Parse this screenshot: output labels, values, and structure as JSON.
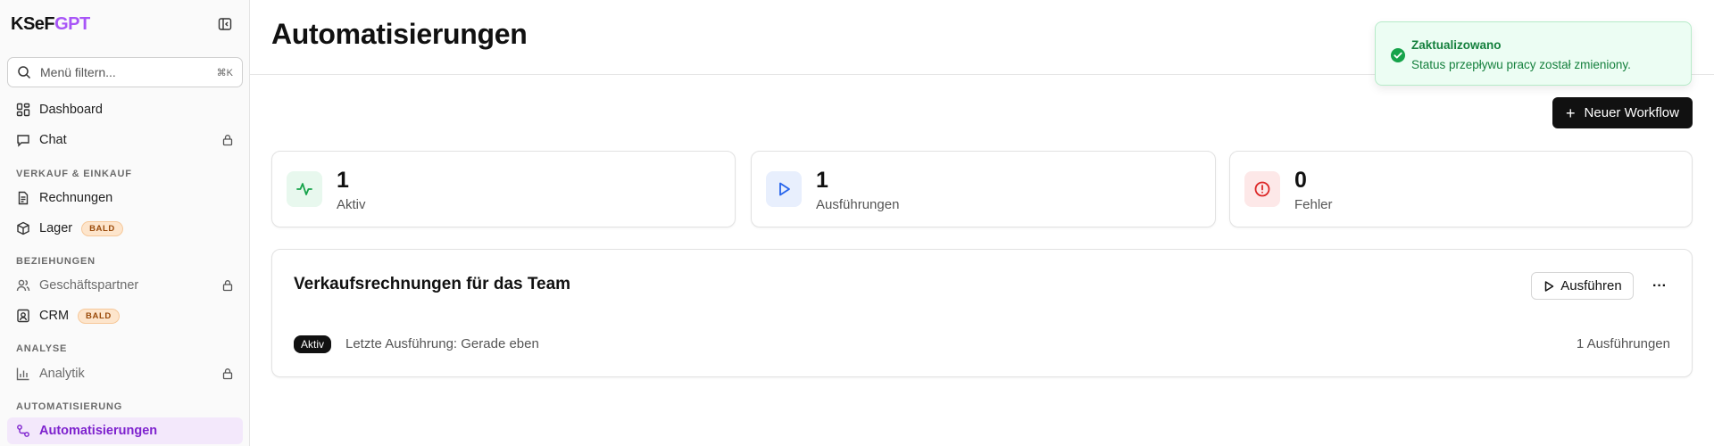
{
  "brand": {
    "part1": "KSeF",
    "part2": "GPT"
  },
  "search": {
    "placeholder": "Menü filtern...",
    "shortcut": "⌘K"
  },
  "sidebar": {
    "items_top": [
      {
        "label": "Dashboard",
        "icon": "dashboard-icon",
        "locked": false
      },
      {
        "label": "Chat",
        "icon": "chat-icon",
        "locked": true
      }
    ],
    "sections": [
      {
        "title": "VERKAUF & EINKAUF",
        "items": [
          {
            "label": "Rechnungen",
            "icon": "invoice-icon"
          },
          {
            "label": "Lager",
            "icon": "package-icon",
            "badge": "BALD"
          }
        ]
      },
      {
        "title": "BEZIEHUNGEN",
        "items": [
          {
            "label": "Geschäftspartner",
            "icon": "users-icon",
            "locked": true
          },
          {
            "label": "CRM",
            "icon": "contact-icon",
            "badge": "BALD"
          }
        ]
      },
      {
        "title": "ANALYSE",
        "items": [
          {
            "label": "Analytik",
            "icon": "bar-chart-icon",
            "locked": true
          }
        ]
      },
      {
        "title": "AUTOMATISIERUNG",
        "items": [
          {
            "label": "Automatisierungen",
            "icon": "workflow-icon",
            "active": true
          }
        ]
      }
    ]
  },
  "header": {
    "title": "Automatisierungen"
  },
  "toolbar": {
    "new_workflow_label": "Neuer Workflow"
  },
  "stats": [
    {
      "value": "1",
      "label": "Aktiv",
      "icon": "activity-icon",
      "color": "#16a34a",
      "bg": "#e8f8ee"
    },
    {
      "value": "1",
      "label": "Ausführungen",
      "icon": "play-icon",
      "color": "#2563eb",
      "bg": "#e8effd"
    },
    {
      "value": "0",
      "label": "Fehler",
      "icon": "alert-circle-icon",
      "color": "#dc2626",
      "bg": "#fde8e8"
    }
  ],
  "workflow": {
    "title": "Verkaufsrechnungen für das Team",
    "run_label": "Ausführen",
    "more_label": "···",
    "status": "Aktiv",
    "last_run": "Letzte Ausführung: Gerade eben",
    "run_count": "1 Ausführungen"
  },
  "toast": {
    "title": "Zaktualizowano",
    "description": "Status przepływu pracy został zmieniony.",
    "icon": "check-circle-icon"
  }
}
